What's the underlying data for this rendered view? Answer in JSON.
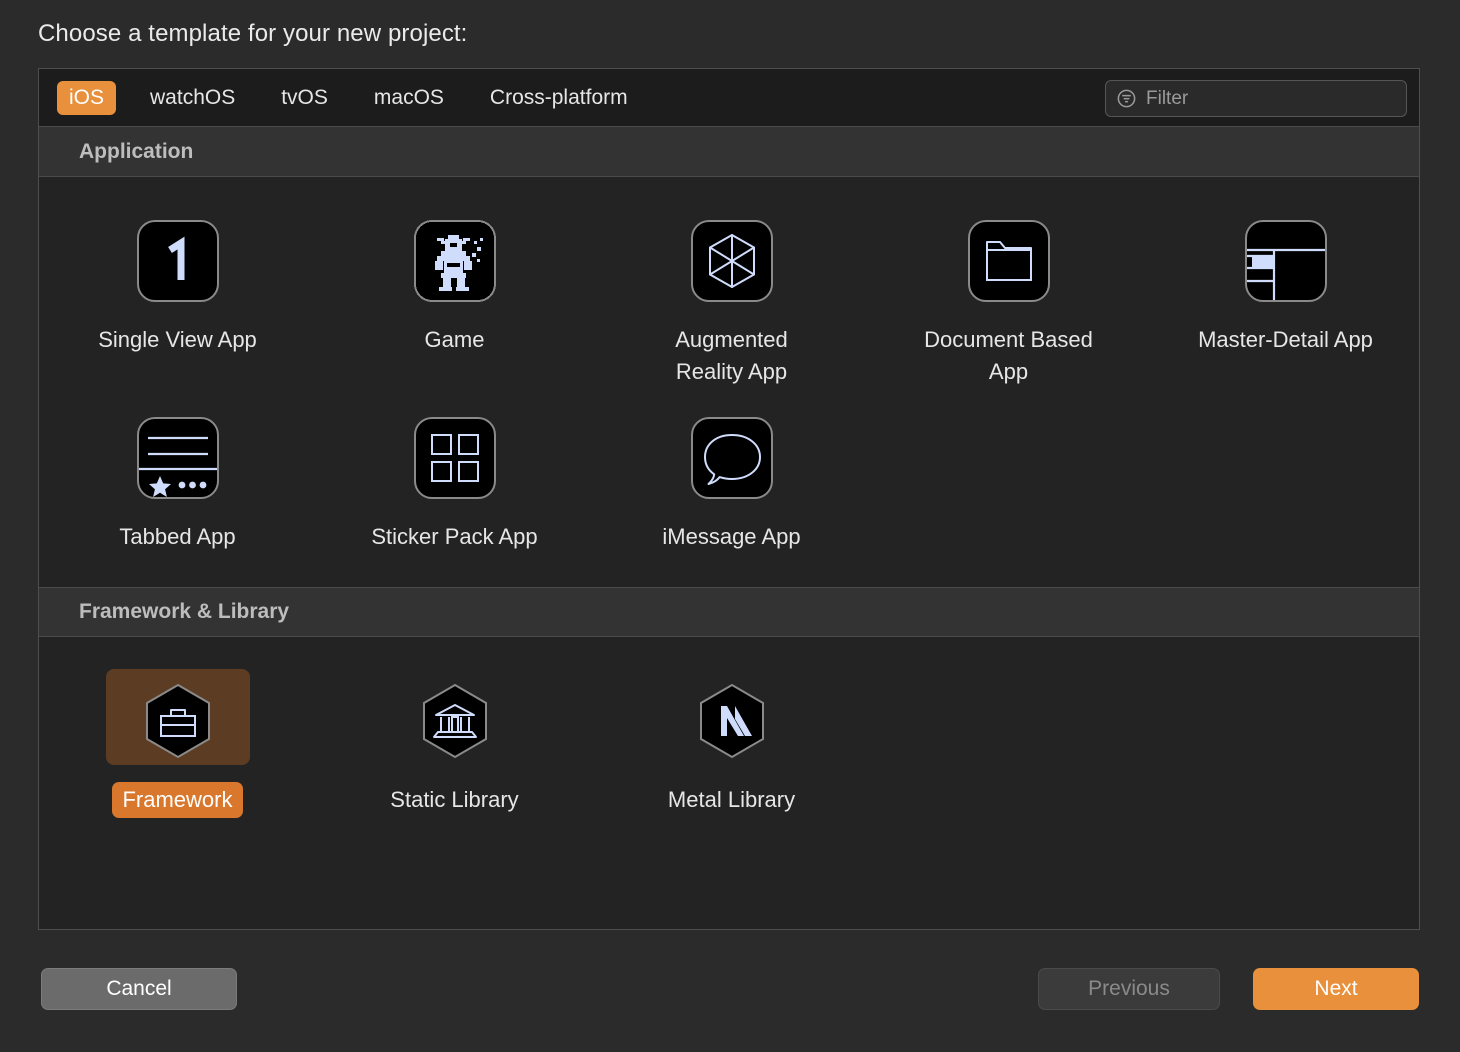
{
  "prompt": {
    "title": "Choose a template for your new project:"
  },
  "tabs": [
    {
      "label": "iOS",
      "selected": true
    },
    {
      "label": "watchOS",
      "selected": false
    },
    {
      "label": "tvOS",
      "selected": false
    },
    {
      "label": "macOS",
      "selected": false
    },
    {
      "label": "Cross-platform",
      "selected": false
    }
  ],
  "filter": {
    "placeholder": "Filter",
    "value": "",
    "icon": "filter-icon"
  },
  "sections": [
    {
      "title": "Application",
      "rows": [
        [
          {
            "label": "Single View App",
            "icon": "number-one-icon",
            "selected": false
          },
          {
            "label": "Game",
            "icon": "robot-icon",
            "selected": false
          },
          {
            "label": "Augmented Reality App",
            "icon": "cube-hexagon-icon",
            "selected": false
          },
          {
            "label": "Document Based App",
            "icon": "folder-icon",
            "selected": false
          },
          {
            "label": "Master-Detail App",
            "icon": "split-view-icon",
            "selected": false
          }
        ],
        [
          {
            "label": "Tabbed App",
            "icon": "tab-bar-icon",
            "selected": false
          },
          {
            "label": "Sticker Pack App",
            "icon": "grid-four-icon",
            "selected": false
          },
          {
            "label": "iMessage App",
            "icon": "speech-bubble-icon",
            "selected": false
          }
        ]
      ]
    },
    {
      "title": "Framework & Library",
      "rows": [
        [
          {
            "label": "Framework",
            "icon": "toolbox-hexagon-icon",
            "selected": true
          },
          {
            "label": "Static Library",
            "icon": "bank-hexagon-icon",
            "selected": false
          },
          {
            "label": "Metal Library",
            "icon": "metal-m-hexagon-icon",
            "selected": false
          }
        ]
      ]
    }
  ],
  "footer": {
    "cancel_label": "Cancel",
    "previous_label": "Previous",
    "next_label": "Next"
  },
  "colors": {
    "accent": "#e8903c",
    "selection_bg": "#5c3c22",
    "selection_label": "#d9772c",
    "icon_glyph": "#cfdcfb",
    "panel_bg": "#232323",
    "section_header_bg": "#333333"
  }
}
